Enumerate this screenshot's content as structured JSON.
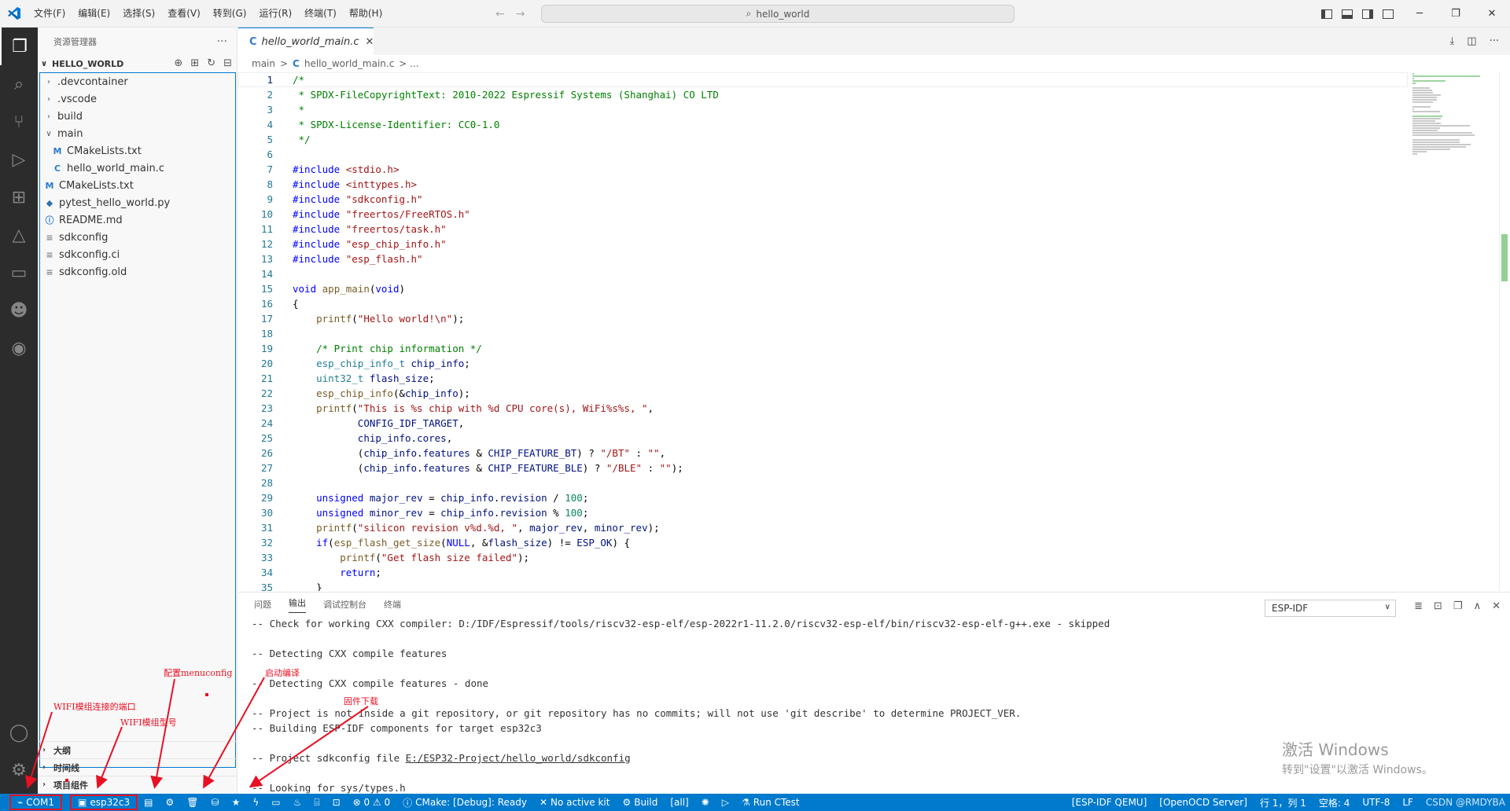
{
  "titlebar": {
    "menu": [
      "文件(F)",
      "编辑(E)",
      "选择(S)",
      "查看(V)",
      "转到(G)",
      "运行(R)",
      "终端(T)",
      "帮助(H)"
    ],
    "search_text": "hello_world",
    "back_icon": "arrow-left-icon",
    "forward_icon": "arrow-right-icon"
  },
  "sidebar": {
    "title": "资源管理器",
    "project": "HELLO_WORLD",
    "tree": [
      {
        "label": ".devcontainer",
        "type": "folder",
        "indent": 1
      },
      {
        "label": ".vscode",
        "type": "folder",
        "indent": 1
      },
      {
        "label": "build",
        "type": "folder",
        "indent": 1
      },
      {
        "label": "main",
        "type": "folder-open",
        "indent": 1
      },
      {
        "label": "CMakeLists.txt",
        "type": "M",
        "indent": 2
      },
      {
        "label": "hello_world_main.c",
        "type": "C",
        "indent": 2
      },
      {
        "label": "CMakeLists.txt",
        "type": "M",
        "indent": 1
      },
      {
        "label": "pytest_hello_world.py",
        "type": "py",
        "indent": 1
      },
      {
        "label": "README.md",
        "type": "info",
        "indent": 1
      },
      {
        "label": "sdkconfig",
        "type": "txt",
        "indent": 1
      },
      {
        "label": "sdkconfig.ci",
        "type": "txt",
        "indent": 1
      },
      {
        "label": "sdkconfig.old",
        "type": "txt",
        "indent": 1
      }
    ],
    "sections": [
      "大纲",
      "时间线",
      "项目组件"
    ]
  },
  "editor": {
    "tab_label": "hello_world_main.c",
    "breadcrumb": [
      "main",
      ">",
      "C",
      "hello_world_main.c",
      "> ..."
    ],
    "lines": [
      "/*",
      " * SPDX-FileCopyrightText: 2010-2022 Espressif Systems (Shanghai) CO LTD",
      " *",
      " * SPDX-License-Identifier: CC0-1.0",
      " */",
      "",
      "#include <stdio.h>",
      "#include <inttypes.h>",
      "#include \"sdkconfig.h\"",
      "#include \"freertos/FreeRTOS.h\"",
      "#include \"freertos/task.h\"",
      "#include \"esp_chip_info.h\"",
      "#include \"esp_flash.h\"",
      "",
      "void app_main(void)",
      "{",
      "    printf(\"Hello world!\\n\");",
      "",
      "    /* Print chip information */",
      "    esp_chip_info_t chip_info;",
      "    uint32_t flash_size;",
      "    esp_chip_info(&chip_info);",
      "    printf(\"This is %s chip with %d CPU core(s), WiFi%s%s, \",",
      "           CONFIG_IDF_TARGET,",
      "           chip_info.cores,",
      "           (chip_info.features & CHIP_FEATURE_BT) ? \"/BT\" : \"\",",
      "           (chip_info.features & CHIP_FEATURE_BLE) ? \"/BLE\" : \"\");",
      "",
      "    unsigned major_rev = chip_info.revision / 100;",
      "    unsigned minor_rev = chip_info.revision % 100;",
      "    printf(\"silicon revision v%d.%d, \", major_rev, minor_rev);",
      "    if(esp_flash_get_size(NULL, &flash_size) != ESP_OK) {",
      "        printf(\"Get flash size failed\");",
      "        return;",
      "    }"
    ]
  },
  "panel": {
    "tabs": [
      "问题",
      "输出",
      "调试控制台",
      "终端"
    ],
    "active_tab": "输出",
    "channel": "ESP-IDF",
    "output": [
      "-- Check for working CXX compiler: D:/IDF/Espressif/tools/riscv32-esp-elf/esp-2022r1-11.2.0/riscv32-esp-elf/bin/riscv32-esp-elf-g++.exe - skipped",
      "",
      "-- Detecting CXX compile features",
      "",
      "-- Detecting CXX compile features - done",
      "",
      "-- Project is not inside a git repository, or git repository has no commits; will not use 'git describe' to determine PROJECT_VER.",
      "-- Building ESP-IDF components for target esp32c3",
      "",
      "-- Project sdkconfig file ",
      "",
      "-- Looking for sys/types.h"
    ],
    "sdkconfig_path": "E:/ESP32-Project/hello_world/sdkconfig"
  },
  "watermark": {
    "title": "激活 Windows",
    "subtitle": "转到\"设置\"以激活 Windows。"
  },
  "statusbar": {
    "port": "COM1",
    "target": "esp32c3",
    "problems": "⊗ 0 ⚠ 0",
    "cmake": "CMake: [Debug]: Ready",
    "kit": "No active kit",
    "build": "Build",
    "all": "[all]",
    "ctest": "Run CTest",
    "qemu": "[ESP-IDF QEMU]",
    "openocd": "[OpenOCD Server]",
    "position": "行 1，列 1",
    "spaces": "空格: 4",
    "encoding": "UTF-8",
    "eol": "LF",
    "watermark_text": "CSDN @RMDYBA"
  },
  "annotations": {
    "menuconfig": "配置menuconfig",
    "compile": "启动编译",
    "flash": "固件下载",
    "port": "WIFI模组连接的端口",
    "model": "WIFI模组型号"
  },
  "colors": {
    "accent": "#007acc",
    "annotation": "#e81123"
  }
}
